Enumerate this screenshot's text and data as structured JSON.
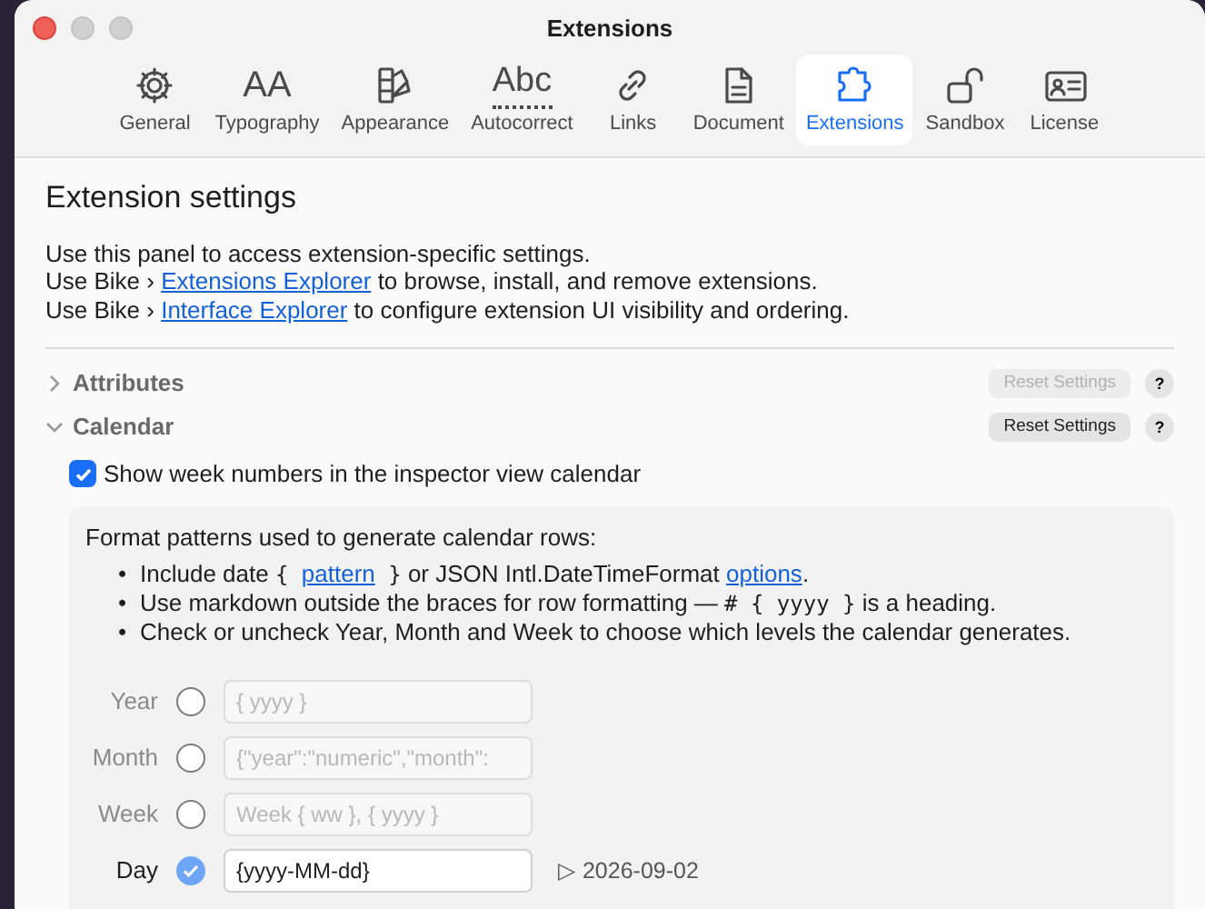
{
  "window": {
    "title": "Extensions"
  },
  "tabs": [
    {
      "label": "General",
      "selected": false
    },
    {
      "label": "Typography",
      "selected": false,
      "glyph": "AA"
    },
    {
      "label": "Appearance",
      "selected": false
    },
    {
      "label": "Autocorrect",
      "selected": false,
      "glyph": "Abc"
    },
    {
      "label": "Links",
      "selected": false
    },
    {
      "label": "Document",
      "selected": false
    },
    {
      "label": "Extensions",
      "selected": true
    },
    {
      "label": "Sandbox",
      "selected": false
    },
    {
      "label": "License",
      "selected": false
    }
  ],
  "heading": "Extension settings",
  "intro": [
    {
      "before": "Use this panel to access extension-specific settings."
    },
    {
      "before": "Use Bike › ",
      "link": "Extensions Explorer",
      "after": " to browse, install, and remove extensions."
    },
    {
      "before": "Use Bike › ",
      "link": "Interface Explorer",
      "after": " to configure extension UI visibility and ordering."
    }
  ],
  "sections": [
    {
      "title": "Attributes",
      "expanded": false,
      "reset_label": "Reset Settings",
      "reset_enabled": false,
      "help": "?"
    },
    {
      "title": "Calendar",
      "expanded": true,
      "reset_label": "Reset Settings",
      "reset_enabled": true,
      "help": "?"
    }
  ],
  "week_numbers": {
    "label": "Show week numbers in the inspector view calendar",
    "checked": true
  },
  "format_box": {
    "intro": "Format patterns used to generate calendar rows:",
    "bullets": [
      {
        "marker": "•",
        "parts": [
          {
            "kind": "text",
            "text": "Include date "
          },
          {
            "kind": "code",
            "text": "{ "
          },
          {
            "kind": "link",
            "text": "pattern"
          },
          {
            "kind": "code",
            "text": " }"
          },
          {
            "kind": "text",
            "text": " or JSON Intl.DateTimeFormat "
          },
          {
            "kind": "link",
            "text": "options"
          },
          {
            "kind": "text",
            "text": "."
          }
        ]
      },
      {
        "marker": "•",
        "parts": [
          {
            "kind": "text",
            "text": "Use markdown outside the braces for row formatting — "
          },
          {
            "kind": "code",
            "text": "# { yyyy }"
          },
          {
            "kind": "text",
            "text": " is a heading."
          }
        ]
      },
      {
        "marker": "•",
        "parts": [
          {
            "kind": "text",
            "text": "Check or uncheck Year, Month and Week to choose which levels the calendar generates."
          }
        ]
      }
    ],
    "rows": [
      {
        "label": "Year",
        "checked": false,
        "disabled": false,
        "placeholder": "{ yyyy }"
      },
      {
        "label": "Month",
        "checked": false,
        "disabled": false,
        "placeholder": "{\"year\":\"numeric\",\"month\":"
      },
      {
        "label": "Week",
        "checked": false,
        "disabled": false,
        "placeholder": "Week { ww }, { yyyy }"
      },
      {
        "label": "Day",
        "checked": true,
        "disabled": true,
        "value": "{yyyy-MM-dd}",
        "preview": "▷ 2026-09-02"
      }
    ]
  }
}
